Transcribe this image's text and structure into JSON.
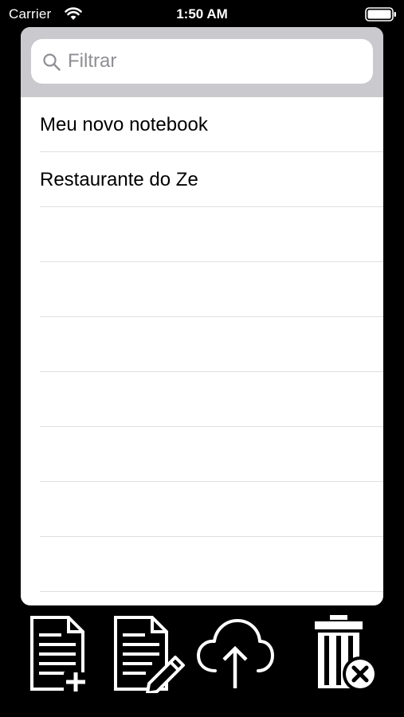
{
  "status_bar": {
    "carrier": "Carrier",
    "time": "1:50 AM"
  },
  "search": {
    "placeholder": "Filtrar",
    "value": ""
  },
  "list": {
    "items": [
      {
        "label": "Meu novo notebook"
      },
      {
        "label": "Restaurante do Ze"
      },
      {
        "label": ""
      },
      {
        "label": ""
      },
      {
        "label": ""
      },
      {
        "label": ""
      },
      {
        "label": ""
      },
      {
        "label": ""
      },
      {
        "label": ""
      }
    ]
  },
  "toolbar": {
    "buttons": [
      {
        "icon": "new-document-icon"
      },
      {
        "icon": "edit-document-icon"
      },
      {
        "icon": "cloud-upload-icon"
      },
      {
        "icon": "delete-trash-icon"
      }
    ]
  },
  "colors": {
    "background": "#000000",
    "card": "#ffffff",
    "search_bar_bg": "#c9c9ce",
    "placeholder": "#8e8e93",
    "separator": "#e0e0e3"
  }
}
